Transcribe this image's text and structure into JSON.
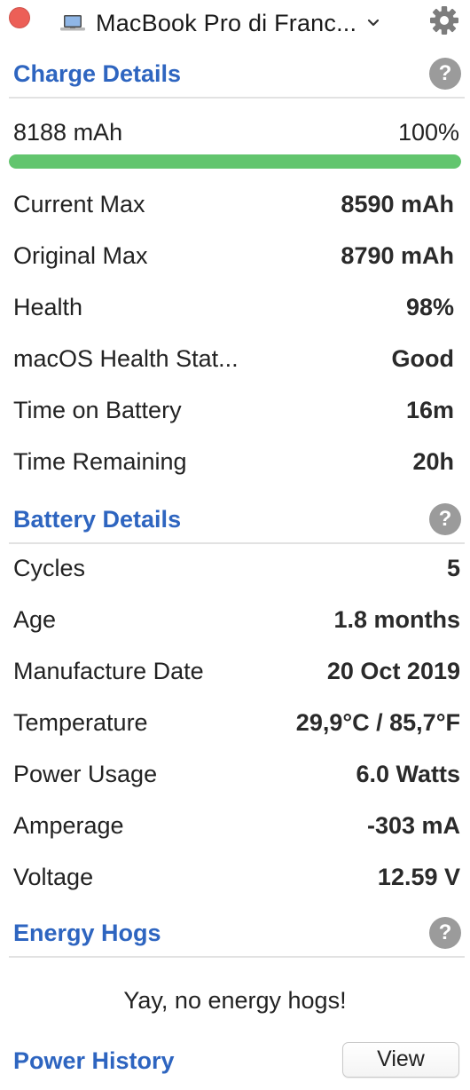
{
  "header": {
    "device_name": "MacBook Pro di Franc...",
    "icons": [
      "close-dot",
      "laptop-icon",
      "chevron-down-icon",
      "gear-icon"
    ],
    "close_color": "#ec5f57"
  },
  "charge_details": {
    "title": "Charge Details",
    "help_label": "?",
    "current_charge": "8188 mAh",
    "percent_label": "100%",
    "charge_fraction": 1.0,
    "bar_color": "#62c56e",
    "rows": [
      {
        "label": "Current Max",
        "value": "8590 mAh"
      },
      {
        "label": "Original Max",
        "value": "8790 mAh"
      },
      {
        "label": "Health",
        "value": "98%"
      },
      {
        "label": "macOS Health Stat...",
        "value": "Good"
      },
      {
        "label": "Time on Battery",
        "value": "16m"
      },
      {
        "label": "Time Remaining",
        "value": "20h"
      }
    ]
  },
  "battery_details": {
    "title": "Battery Details",
    "help_label": "?",
    "rows": [
      {
        "label": "Cycles",
        "value": "5"
      },
      {
        "label": "Age",
        "value": "1.8 months"
      },
      {
        "label": "Manufacture Date",
        "value": "20 Oct 2019"
      },
      {
        "label": "Temperature",
        "value": "29,9°C / 85,7°F"
      },
      {
        "label": "Power Usage",
        "value": "6.0 Watts"
      },
      {
        "label": "Amperage",
        "value": "-303 mA"
      },
      {
        "label": "Voltage",
        "value": "12.59 V"
      }
    ]
  },
  "energy_hogs": {
    "title": "Energy Hogs",
    "help_label": "?",
    "empty_message": "Yay, no energy hogs!"
  },
  "power_history": {
    "title": "Power History",
    "view_label": "View"
  },
  "accent_color": "#2e65c0"
}
